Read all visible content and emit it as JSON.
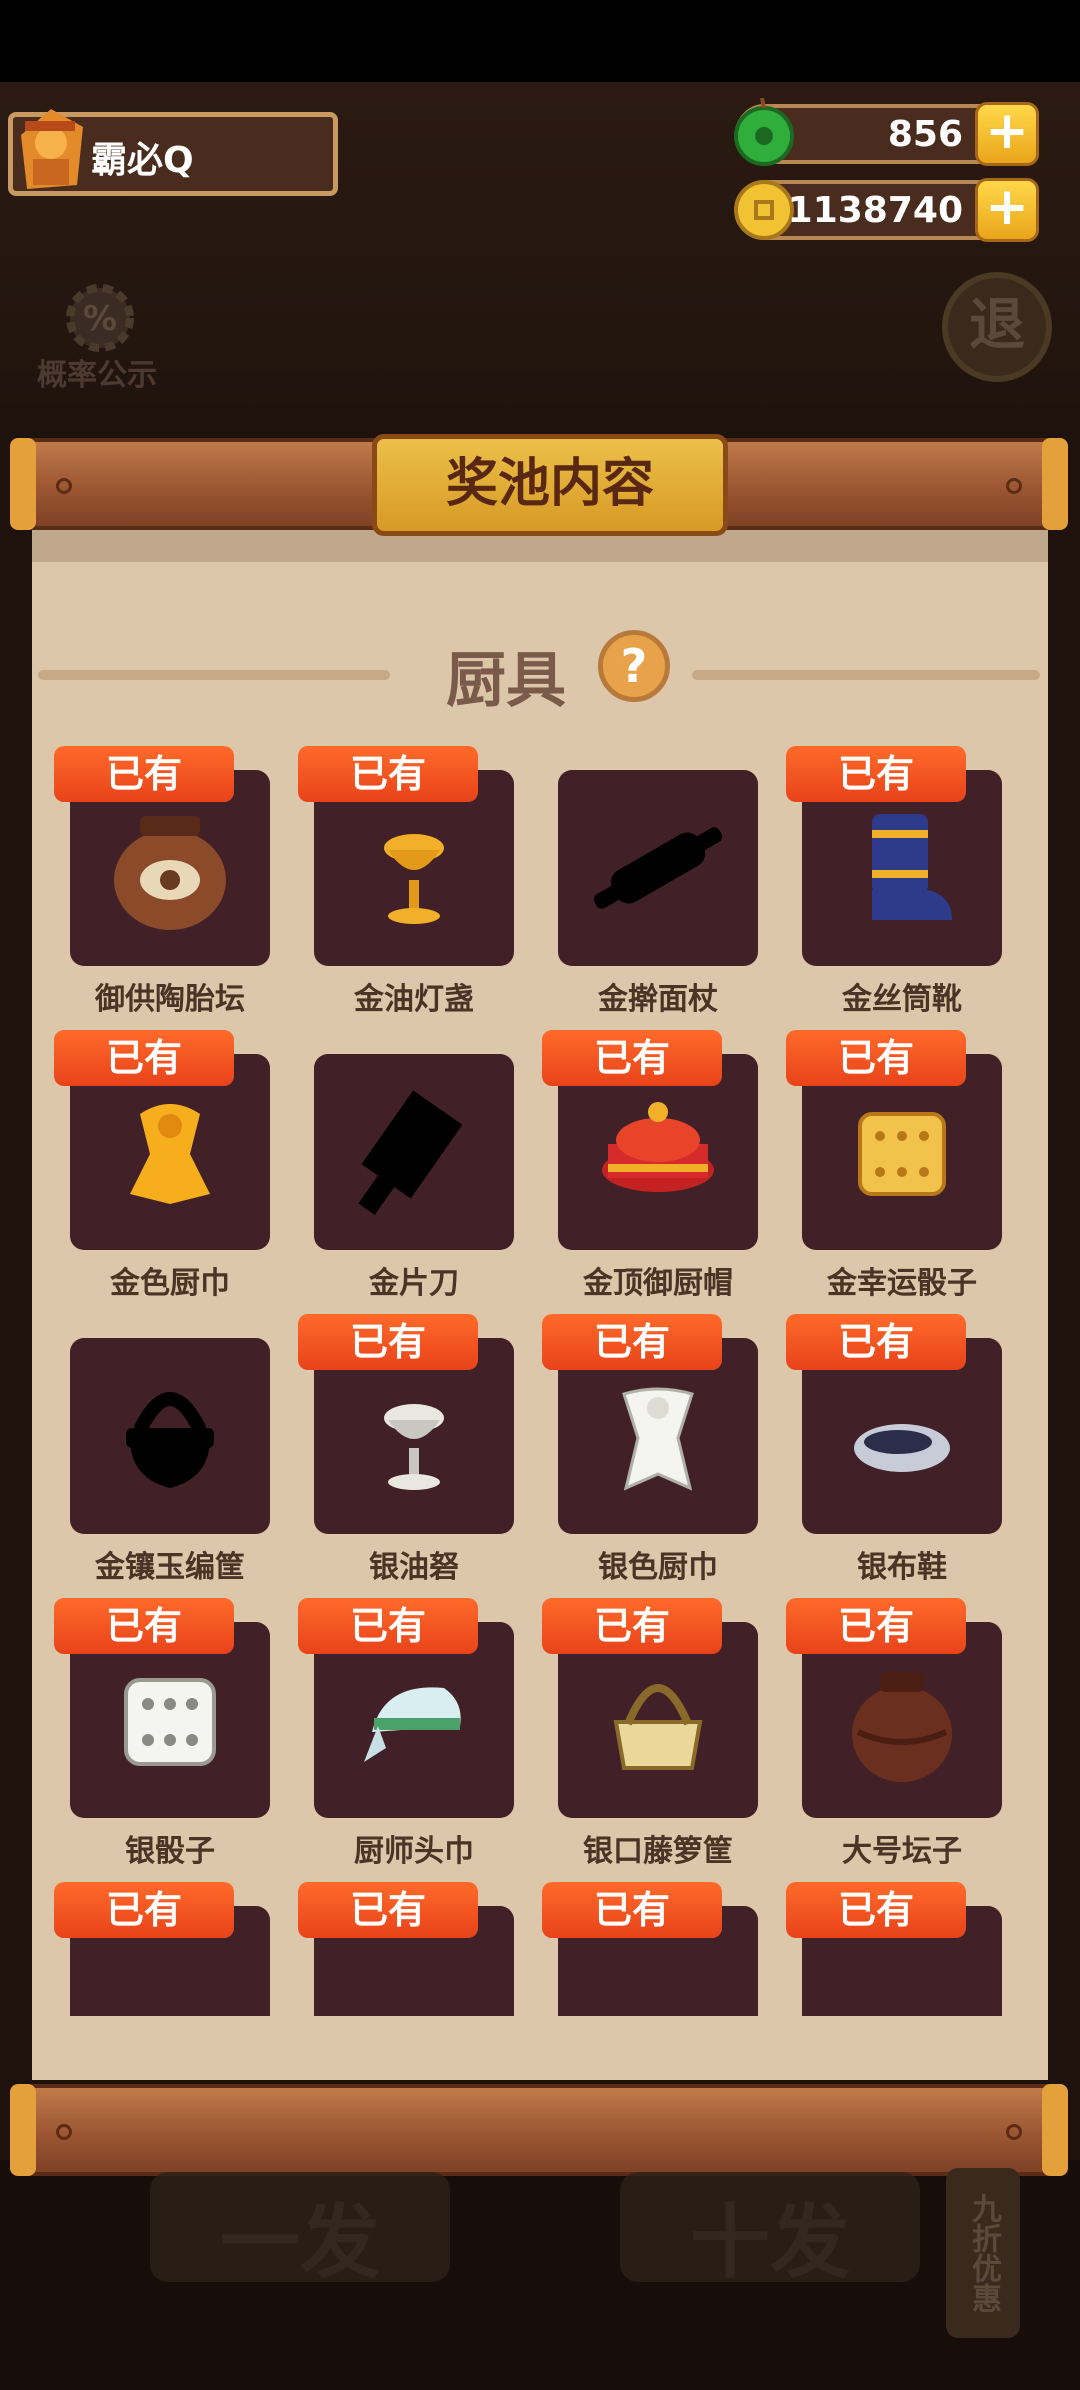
{
  "player": {
    "name": "霸必Q"
  },
  "currency": {
    "jade": {
      "value": "856",
      "plus": "+"
    },
    "coins": {
      "value": "1138740",
      "plus": "+"
    }
  },
  "controls": {
    "probability_label": "概率公示",
    "exit_label": "退"
  },
  "panel": {
    "title": "奖池内容",
    "section": "厨具",
    "help": "?"
  },
  "owned_label": "已有",
  "items": [
    {
      "name": "御供陶胎坛",
      "owned": true,
      "icon": "jar-icon"
    },
    {
      "name": "金油灯盏",
      "owned": true,
      "icon": "gold-lamp-icon"
    },
    {
      "name": "金擀面杖",
      "owned": false,
      "icon": "rolling-pin-icon"
    },
    {
      "name": "金丝筒靴",
      "owned": true,
      "icon": "boot-icon"
    },
    {
      "name": "金色厨巾",
      "owned": true,
      "icon": "gold-kerchief-icon"
    },
    {
      "name": "金片刀",
      "owned": false,
      "icon": "cleaver-icon"
    },
    {
      "name": "金顶御厨帽",
      "owned": true,
      "icon": "chef-hat-icon"
    },
    {
      "name": "金幸运骰子",
      "owned": true,
      "icon": "gold-dice-icon"
    },
    {
      "name": "金镶玉编筐",
      "owned": false,
      "icon": "basket-silhouette-icon"
    },
    {
      "name": "银油砮",
      "owned": true,
      "icon": "silver-lamp-icon"
    },
    {
      "name": "银色厨巾",
      "owned": true,
      "icon": "silver-kerchief-icon"
    },
    {
      "name": "银布鞋",
      "owned": true,
      "icon": "cloth-shoe-icon"
    },
    {
      "name": "银骰子",
      "owned": true,
      "icon": "silver-dice-icon"
    },
    {
      "name": "厨师头巾",
      "owned": true,
      "icon": "bandana-icon"
    },
    {
      "name": "银口藤箩筐",
      "owned": true,
      "icon": "rattan-basket-icon"
    },
    {
      "name": "大号坛子",
      "owned": true,
      "icon": "big-jar-icon"
    },
    {
      "name": "",
      "owned": true,
      "icon": "rolling-pin-partial-icon"
    },
    {
      "name": "",
      "owned": true,
      "icon": "knife-partial-icon"
    },
    {
      "name": "",
      "owned": true,
      "icon": "kerchief-partial-icon"
    },
    {
      "name": "",
      "owned": true,
      "icon": "jar-partial-icon"
    }
  ],
  "bottom": {
    "single_draw": "一发",
    "ten_draw": "十发",
    "discount": "九折优惠"
  },
  "colors": {
    "owned_tag": "#ef4f1d",
    "item_box": "#412127",
    "panel_body": "#ddc7aa",
    "title_plate": "#e0ad36"
  }
}
